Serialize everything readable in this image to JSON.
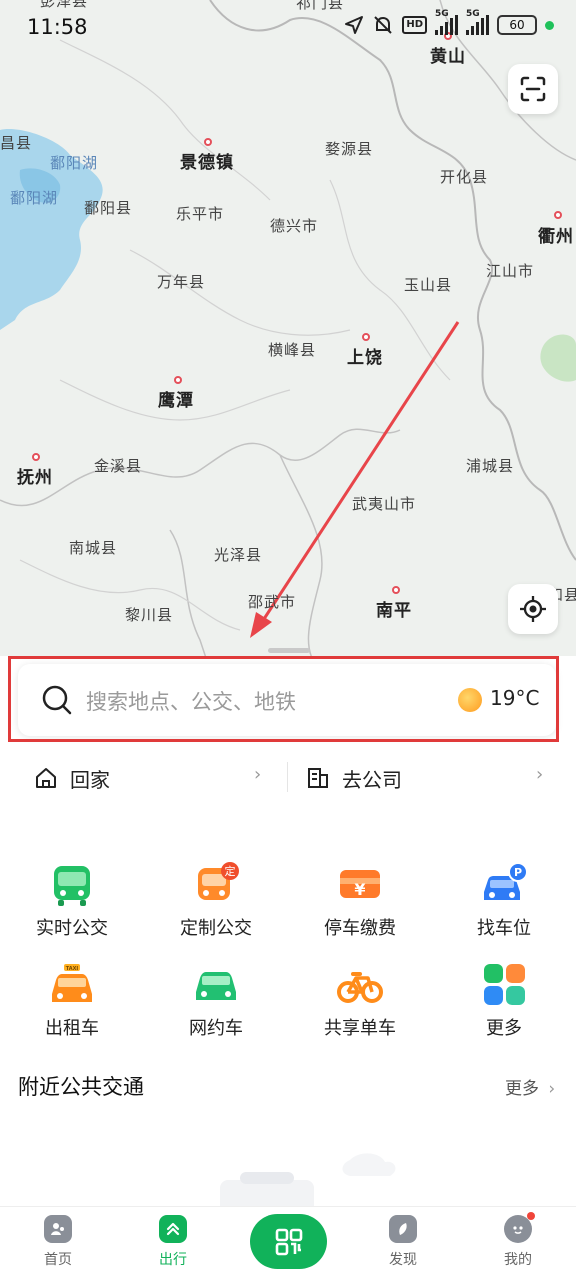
{
  "status_bar": {
    "time": "11:58",
    "network_left": "5G",
    "network_right": "5G",
    "hd_label": "HD",
    "battery": "60"
  },
  "map": {
    "labels": [
      {
        "text": "黄山",
        "kind": "city"
      },
      {
        "text": "景德镇",
        "kind": "city"
      },
      {
        "text": "婺源县",
        "kind": "county"
      },
      {
        "text": "开化县",
        "kind": "county"
      },
      {
        "text": "衢州",
        "kind": "city"
      },
      {
        "text": "鄱阳湖",
        "kind": "water"
      },
      {
        "text": "鄱阳湖",
        "kind": "water"
      },
      {
        "text": "鄱阳县",
        "kind": "county"
      },
      {
        "text": "乐平市",
        "kind": "county"
      },
      {
        "text": "德兴市",
        "kind": "county"
      },
      {
        "text": "江山市",
        "kind": "county"
      },
      {
        "text": "玉山县",
        "kind": "county"
      },
      {
        "text": "万年县",
        "kind": "county"
      },
      {
        "text": "横峰县",
        "kind": "county"
      },
      {
        "text": "上饶",
        "kind": "city"
      },
      {
        "text": "鹰潭",
        "kind": "city"
      },
      {
        "text": "抚州",
        "kind": "city"
      },
      {
        "text": "金溪县",
        "kind": "county"
      },
      {
        "text": "浦城县",
        "kind": "county"
      },
      {
        "text": "武夷山市",
        "kind": "county"
      },
      {
        "text": "南城县",
        "kind": "county"
      },
      {
        "text": "光泽县",
        "kind": "county"
      },
      {
        "text": "邵武市",
        "kind": "county"
      },
      {
        "text": "黎川县",
        "kind": "county"
      },
      {
        "text": "南平",
        "kind": "city"
      },
      {
        "text": "屏",
        "kind": "county"
      },
      {
        "text": "和县",
        "kind": "county"
      },
      {
        "text": "昌县",
        "kind": "county"
      },
      {
        "text": "祁门县",
        "kind": "county"
      },
      {
        "text": "彭泽县",
        "kind": "county"
      }
    ]
  },
  "search": {
    "placeholder": "搜索地点、公交、地铁",
    "temperature": "19°C"
  },
  "shortcuts": {
    "home": "回家",
    "office": "去公司"
  },
  "services": [
    {
      "label": "实时公交",
      "icon": "bus-icon"
    },
    {
      "label": "定制公交",
      "icon": "custom-bus-icon",
      "badge": "定"
    },
    {
      "label": "停车缴费",
      "icon": "parking-fee-icon",
      "symbol": "¥"
    },
    {
      "label": "找车位",
      "icon": "find-parking-icon",
      "badge": "P"
    },
    {
      "label": "出租车",
      "icon": "taxi-icon",
      "badge": "TAXI"
    },
    {
      "label": "网约车",
      "icon": "ride-hailing-icon"
    },
    {
      "label": "共享单车",
      "icon": "bike-icon"
    },
    {
      "label": "更多",
      "icon": "more-grid-icon"
    }
  ],
  "nearby": {
    "title": "附近公共交通",
    "more": "更多"
  },
  "nav": {
    "home": "首页",
    "travel": "出行",
    "discover": "发现",
    "mine": "我的"
  },
  "colors": {
    "brand_green": "#11b25a",
    "highlight_red": "#e03a3a",
    "annotation_arrow": "#e8454a"
  }
}
